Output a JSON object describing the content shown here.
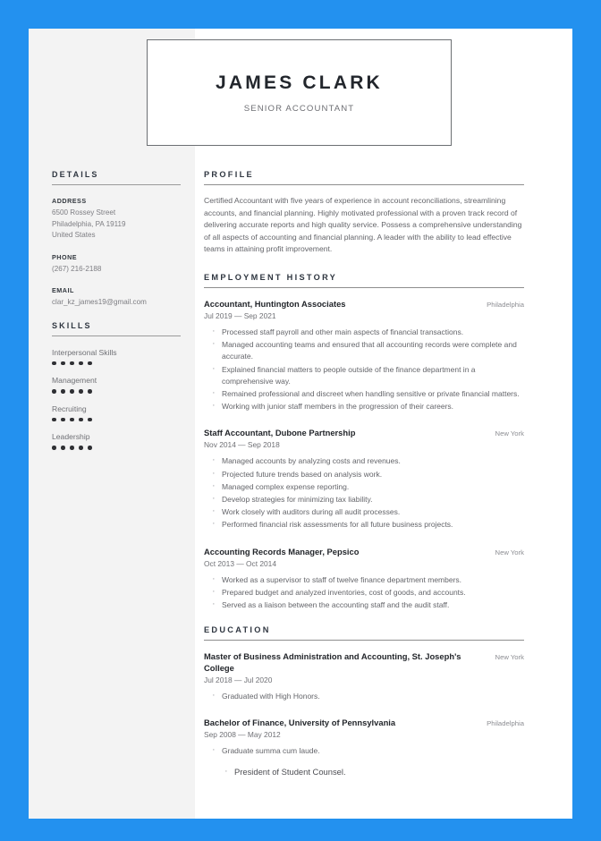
{
  "theme": {
    "frame_color": "#2391ef",
    "sidebar_bg": "#f3f3f3",
    "page_bg": "#ffffff",
    "heading_color": "#2f3640",
    "body_color": "#64656a"
  },
  "header": {
    "name": "JAMES CLARK",
    "title": "SENIOR ACCOUNTANT"
  },
  "sidebar": {
    "details": {
      "title": "DETAILS",
      "fields": [
        {
          "label": "ADDRESS",
          "value": "6500 Rossey Street\nPhiladelphia, PA 19119\nUnited States"
        },
        {
          "label": "PHONE",
          "value": "(267) 216-2188"
        },
        {
          "label": "EMAIL",
          "value": "clar_kz_james19@gmail.com"
        }
      ]
    },
    "skills": {
      "title": "SKILLS",
      "items": [
        {
          "name": "Interpersonal Skills",
          "rating": 5,
          "max": 5
        },
        {
          "name": "Management",
          "rating": 5,
          "max": 5
        },
        {
          "name": "Recruiting",
          "rating": 5,
          "max": 5
        },
        {
          "name": "Leadership",
          "rating": 5,
          "max": 5
        }
      ]
    }
  },
  "main": {
    "profile": {
      "title": "PROFILE",
      "text": "Certified Accountant with five years of experience in account reconciliations, streamlining accounts, and financial planning. Highly motivated professional with a proven track record of delivering accurate reports and high quality service. Possess a comprehensive understanding of all aspects of accounting and financial planning. A leader with the ability to lead effective teams in attaining profit improvement."
    },
    "employment": {
      "title": "EMPLOYMENT HISTORY",
      "entries": [
        {
          "role": "Accountant, Huntington Associates",
          "location": "Philadelphia",
          "dates": "Jul 2019 — Sep 2021",
          "bullets": [
            "Processed staff payroll and other main aspects of financial transactions.",
            "Managed accounting teams and ensured that all accounting records were complete and accurate.",
            "Explained financial matters to people outside of the finance department in a comprehensive way.",
            "Remained professional and discreet when handling sensitive or private financial matters.",
            "Working with junior staff members in the progression of their careers."
          ]
        },
        {
          "role": "Staff Accountant, Dubone Partnership",
          "location": "New York",
          "dates": "Nov 2014 — Sep 2018",
          "bullets": [
            "Managed accounts by analyzing costs and revenues.",
            "Projected future trends based on analysis work.",
            "Managed complex expense reporting.",
            "Develop strategies for minimizing tax liability.",
            "Work closely with auditors during all audit processes.",
            "Performed financial risk assessments for all future business projects."
          ]
        },
        {
          "role": "Accounting Records Manager, Pepsico",
          "location": "New York",
          "dates": "Oct 2013 — Oct 2014",
          "bullets": [
            "Worked as a supervisor to staff of twelve finance department members.",
            "Prepared budget and analyzed inventories, cost of goods, and accounts.",
            "Served as a liaison between the accounting staff and the audit staff."
          ]
        }
      ]
    },
    "education": {
      "title": "EDUCATION",
      "entries": [
        {
          "degree": "Master of Business Administration and Accounting, St. Joseph's College",
          "location": "New York",
          "dates": "Jul 2018 — Jul 2020",
          "bullets": [
            "Graduated with High Honors."
          ]
        },
        {
          "degree": "Bachelor of Finance, University of Pennsylvania",
          "location": "Philadelphia",
          "dates": "Sep 2008 — May 2012",
          "bullets": [
            "Graduate summa cum laude.",
            "President of Student Counsel."
          ],
          "emphasis_from": 1
        }
      ]
    }
  }
}
